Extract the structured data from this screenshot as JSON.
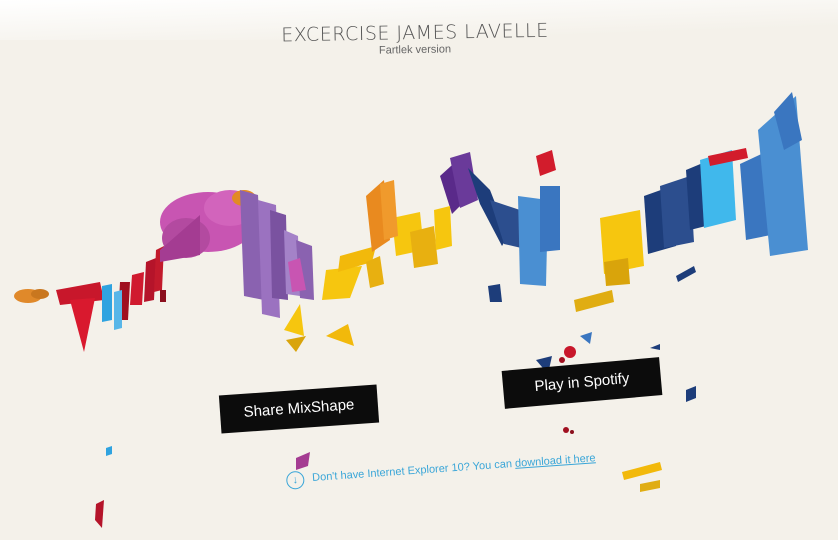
{
  "header": {
    "title": "EXCERCISE JAMES LAVELLE",
    "subtitle": "Fartlek version"
  },
  "buttons": {
    "share_label": "Share MixShape",
    "spotify_label": "Play in Spotify"
  },
  "ie_notice": {
    "icon": "download-icon",
    "text": "Don't have Internet Explorer 10? You can",
    "link_label": "download it here"
  },
  "colors": {
    "background": "#f4f1ea",
    "button_bg": "#0c0c0c",
    "link_blue": "#3aa6d8"
  }
}
